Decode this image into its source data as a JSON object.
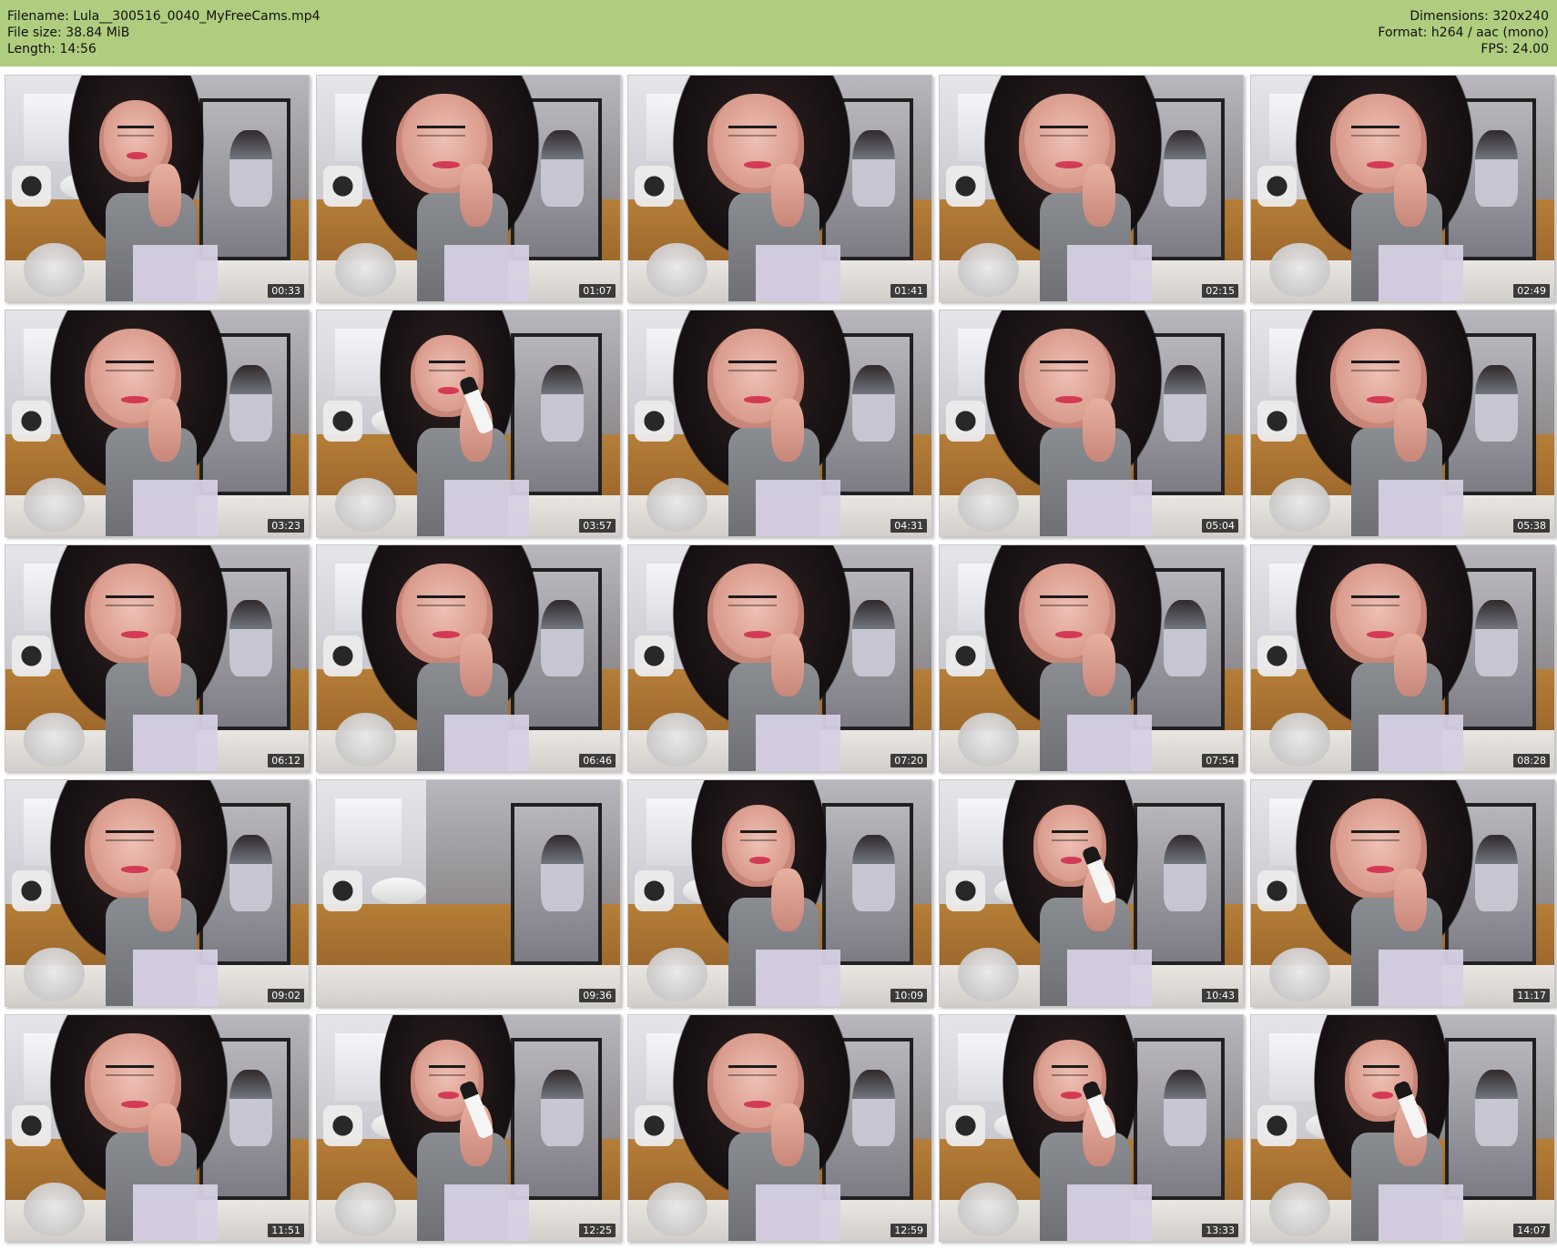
{
  "header": {
    "filename": "Filename: Lula__300516_0040_MyFreeCams.mp4",
    "file_size": "File size: 38.84 MiB",
    "length": "Length: 14:56",
    "dimensions": "Dimensions: 320x240",
    "format": "Format: h264 / aac (mono)",
    "fps": "FPS: 24.00"
  },
  "thumbnails": [
    {
      "time": "00:33",
      "variant": "lean-left"
    },
    {
      "time": "01:07",
      "variant": "closeup"
    },
    {
      "time": "01:41",
      "variant": "closeup"
    },
    {
      "time": "02:15",
      "variant": "closeup"
    },
    {
      "time": "02:49",
      "variant": "closeup"
    },
    {
      "time": "03:23",
      "variant": "closeup"
    },
    {
      "time": "03:57",
      "variant": "product"
    },
    {
      "time": "04:31",
      "variant": "closeup"
    },
    {
      "time": "05:04",
      "variant": "closeup"
    },
    {
      "time": "05:38",
      "variant": "closeup"
    },
    {
      "time": "06:12",
      "variant": "closeup"
    },
    {
      "time": "06:46",
      "variant": "closeup"
    },
    {
      "time": "07:20",
      "variant": "closeup"
    },
    {
      "time": "07:54",
      "variant": "closeup"
    },
    {
      "time": "08:28",
      "variant": "closeup"
    },
    {
      "time": "09:02",
      "variant": "closeup"
    },
    {
      "time": "09:36",
      "variant": "empty-room"
    },
    {
      "time": "10:09",
      "variant": "sitting"
    },
    {
      "time": "10:43",
      "variant": "product"
    },
    {
      "time": "11:17",
      "variant": "closeup"
    },
    {
      "time": "11:51",
      "variant": "closeup"
    },
    {
      "time": "12:25",
      "variant": "product"
    },
    {
      "time": "12:59",
      "variant": "closeup"
    },
    {
      "time": "13:33",
      "variant": "product"
    },
    {
      "time": "14:07",
      "variant": "product"
    }
  ]
}
